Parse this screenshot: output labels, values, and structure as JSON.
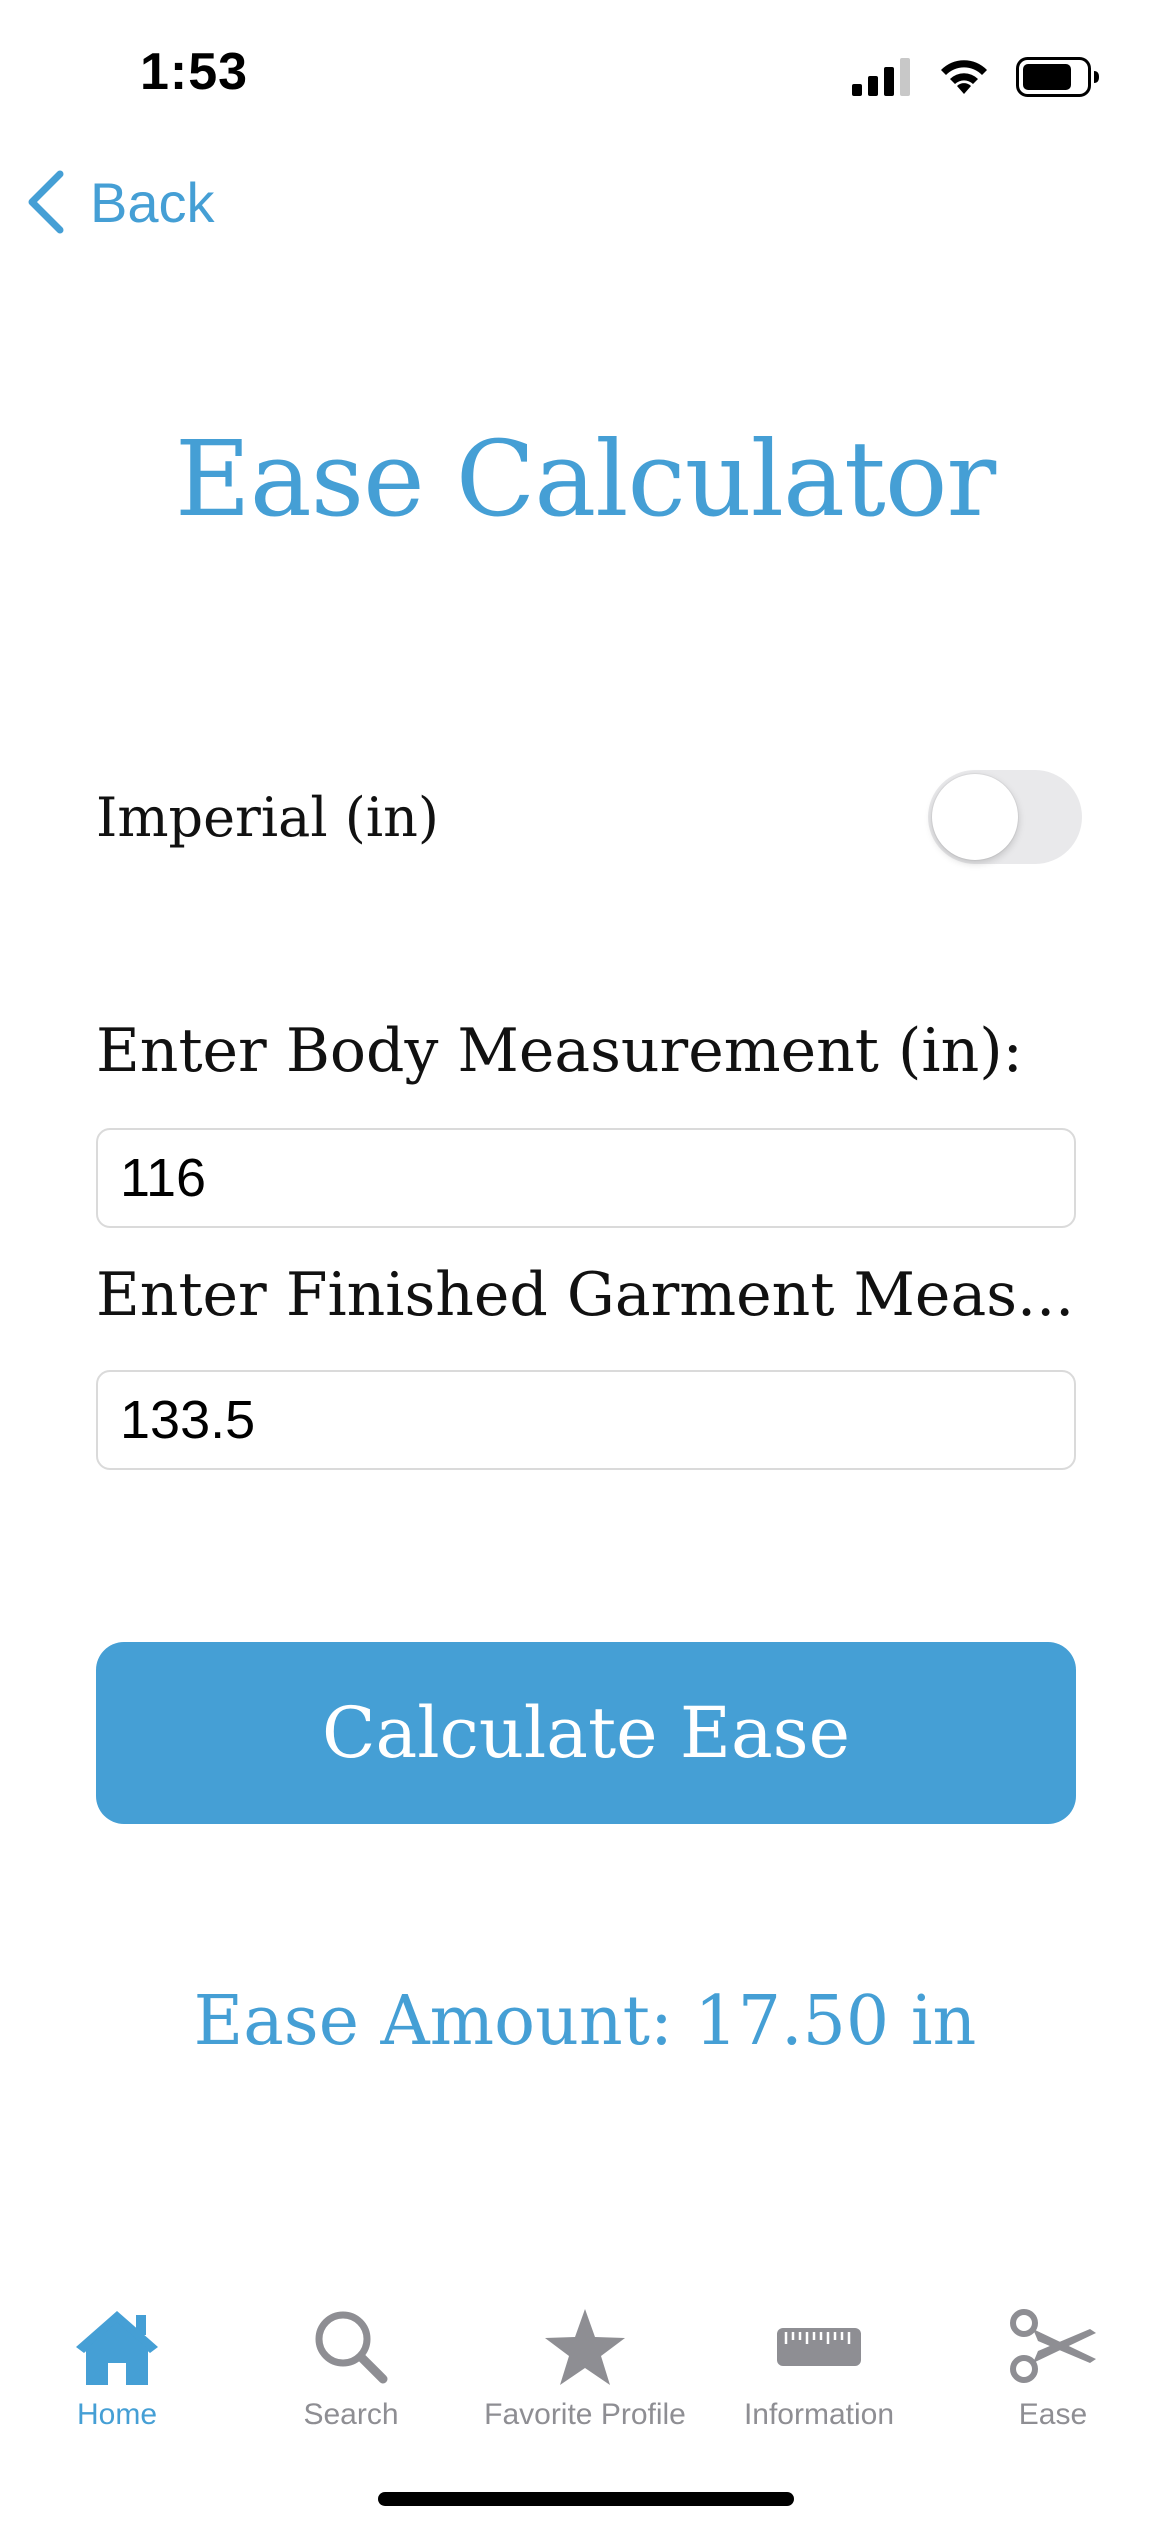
{
  "status_bar": {
    "time": "1:53"
  },
  "nav": {
    "back_label": "Back"
  },
  "title": "Ease Calculator",
  "unit_toggle": {
    "label": "Imperial (in)",
    "on": false
  },
  "fields": [
    {
      "label": "Enter Body Measurement (in):",
      "value": "116"
    },
    {
      "label": "Enter Finished Garment Meas...",
      "value": "133.5"
    }
  ],
  "calculate_button_label": "Calculate Ease",
  "result_text": "Ease Amount: 17.50 in",
  "tabs": [
    {
      "label": "Home",
      "icon": "house-icon",
      "active": true
    },
    {
      "label": "Search",
      "icon": "magnifier-icon",
      "active": false
    },
    {
      "label": "Favorite Profile",
      "icon": "star-icon",
      "active": false
    },
    {
      "label": "Information",
      "icon": "ruler-icon",
      "active": false
    },
    {
      "label": "Ease",
      "icon": "scissors-icon",
      "active": false
    }
  ],
  "colors": {
    "accent": "#459fd5",
    "inactive_tab": "#8e8e93",
    "toggle_off": "#e9e9eb"
  }
}
